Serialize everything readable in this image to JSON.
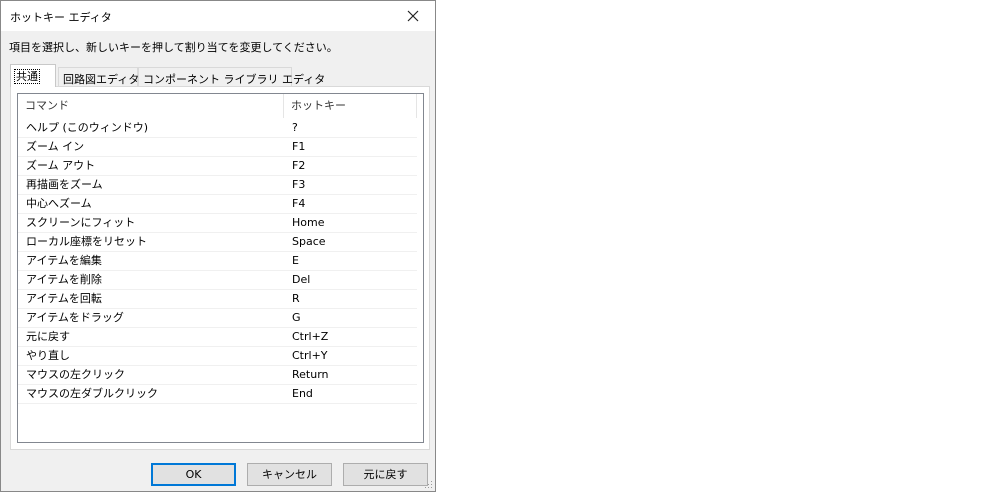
{
  "window": {
    "title": "ホットキー エディタ"
  },
  "instruction": "項目を選択し、新しいキーを押して割り当てを変更してください。",
  "tabs": [
    {
      "label": "共通"
    },
    {
      "label": "回路図エディタ"
    },
    {
      "label": "コンポーネント ライブラリ エディタ"
    }
  ],
  "table": {
    "columns": [
      "コマンド",
      "ホットキー"
    ],
    "rows": [
      {
        "command": "ヘルプ (このウィンドウ)",
        "hotkey": "?"
      },
      {
        "command": "ズーム イン",
        "hotkey": "F1"
      },
      {
        "command": "ズーム アウト",
        "hotkey": "F2"
      },
      {
        "command": "再描画をズーム",
        "hotkey": "F3"
      },
      {
        "command": "中心へズーム",
        "hotkey": "F4"
      },
      {
        "command": "スクリーンにフィット",
        "hotkey": "Home"
      },
      {
        "command": "ローカル座標をリセット",
        "hotkey": "Space"
      },
      {
        "command": "アイテムを編集",
        "hotkey": "E"
      },
      {
        "command": "アイテムを削除",
        "hotkey": "Del"
      },
      {
        "command": "アイテムを回転",
        "hotkey": "R"
      },
      {
        "command": "アイテムをドラッグ",
        "hotkey": "G"
      },
      {
        "command": "元に戻す",
        "hotkey": "Ctrl+Z"
      },
      {
        "command": "やり直し",
        "hotkey": "Ctrl+Y"
      },
      {
        "command": "マウスの左クリック",
        "hotkey": "Return"
      },
      {
        "command": "マウスの左ダブルクリック",
        "hotkey": "End"
      }
    ]
  },
  "buttons": {
    "ok": "OK",
    "cancel": "キャンセル",
    "revert": "元に戻す"
  },
  "icons": {
    "close": "close-icon",
    "grip": "resize-grip-icon"
  },
  "colors": {
    "accent": "#0078d7",
    "window_bg": "#f0f0f0"
  }
}
